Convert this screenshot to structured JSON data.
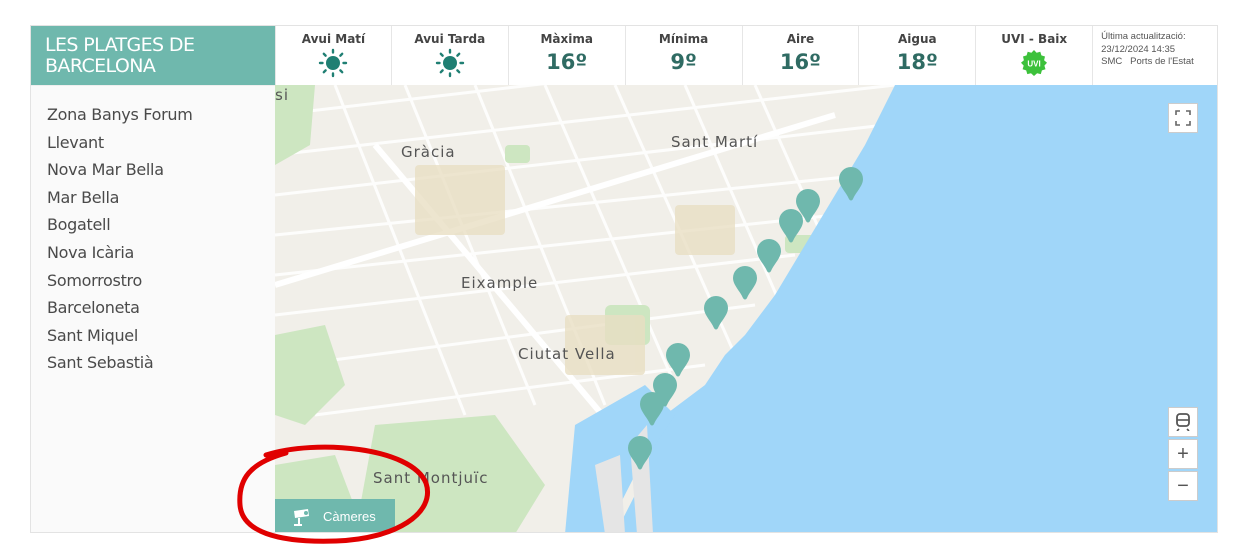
{
  "brand": {
    "title": "LES PLATGES DE BARCELONA"
  },
  "weather": [
    {
      "label": "Avui Matí",
      "icon": "sun-icon"
    },
    {
      "label": "Avui Tarda",
      "icon": "sun-icon"
    },
    {
      "label": "Màxima",
      "value": "16º"
    },
    {
      "label": "Mínima",
      "value": "9º"
    },
    {
      "label": "Aire",
      "value": "16º"
    },
    {
      "label": "Aigua",
      "value": "18º"
    },
    {
      "label": "UVI - Baix",
      "badge": "UVI"
    }
  ],
  "updated": {
    "label": "Última actualització:",
    "datetime": "23/12/2024 14:35",
    "sources": "SMC   Ports de l'Estat"
  },
  "beaches": [
    "Zona Banys Forum",
    "Llevant",
    "Nova Mar Bella",
    "Mar Bella",
    "Bogatell",
    "Nova Icària",
    "Somorrostro",
    "Barceloneta",
    "Sant Miquel",
    "Sant Sebastià"
  ],
  "map": {
    "districts": [
      "Gràcia",
      "Sant Martí",
      "Eixample",
      "Ciutat Vella",
      "Sant Montjuïc",
      "si"
    ],
    "cameras_label": "Càmeres",
    "controls": [
      "fullscreen-icon",
      "train-icon",
      "zoom-in-icon",
      "zoom-out-icon"
    ]
  },
  "colors": {
    "brand": "#6fb8ad",
    "sea": "#a0d6f9",
    "marker": "#6fb8ad",
    "uvi": "#3cc13b",
    "annotation": "#e00000"
  }
}
